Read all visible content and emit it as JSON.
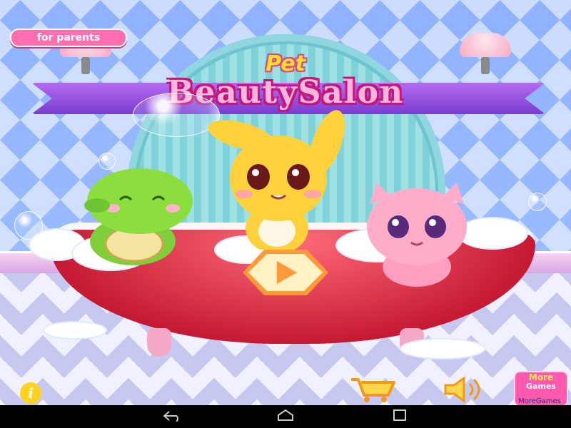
{
  "parents_button": {
    "label": "for parents"
  },
  "title": {
    "line1": "Pet",
    "line2": "BeautySalon"
  },
  "bottom_bar": {
    "info_icon": "i",
    "cart_icon": "cart-icon",
    "sound_icon": "speaker-icon",
    "more_games": {
      "face_label": "More",
      "button_label": "Games",
      "caption": "MoreGames"
    }
  },
  "android_nav": {
    "back": "back-icon",
    "home": "home-icon",
    "recents": "recents-icon"
  },
  "colors": {
    "accent": "#ff5ab0",
    "play": "#ff9a3b",
    "tub": "#c51a34",
    "curtain": "#7fd2d8"
  }
}
